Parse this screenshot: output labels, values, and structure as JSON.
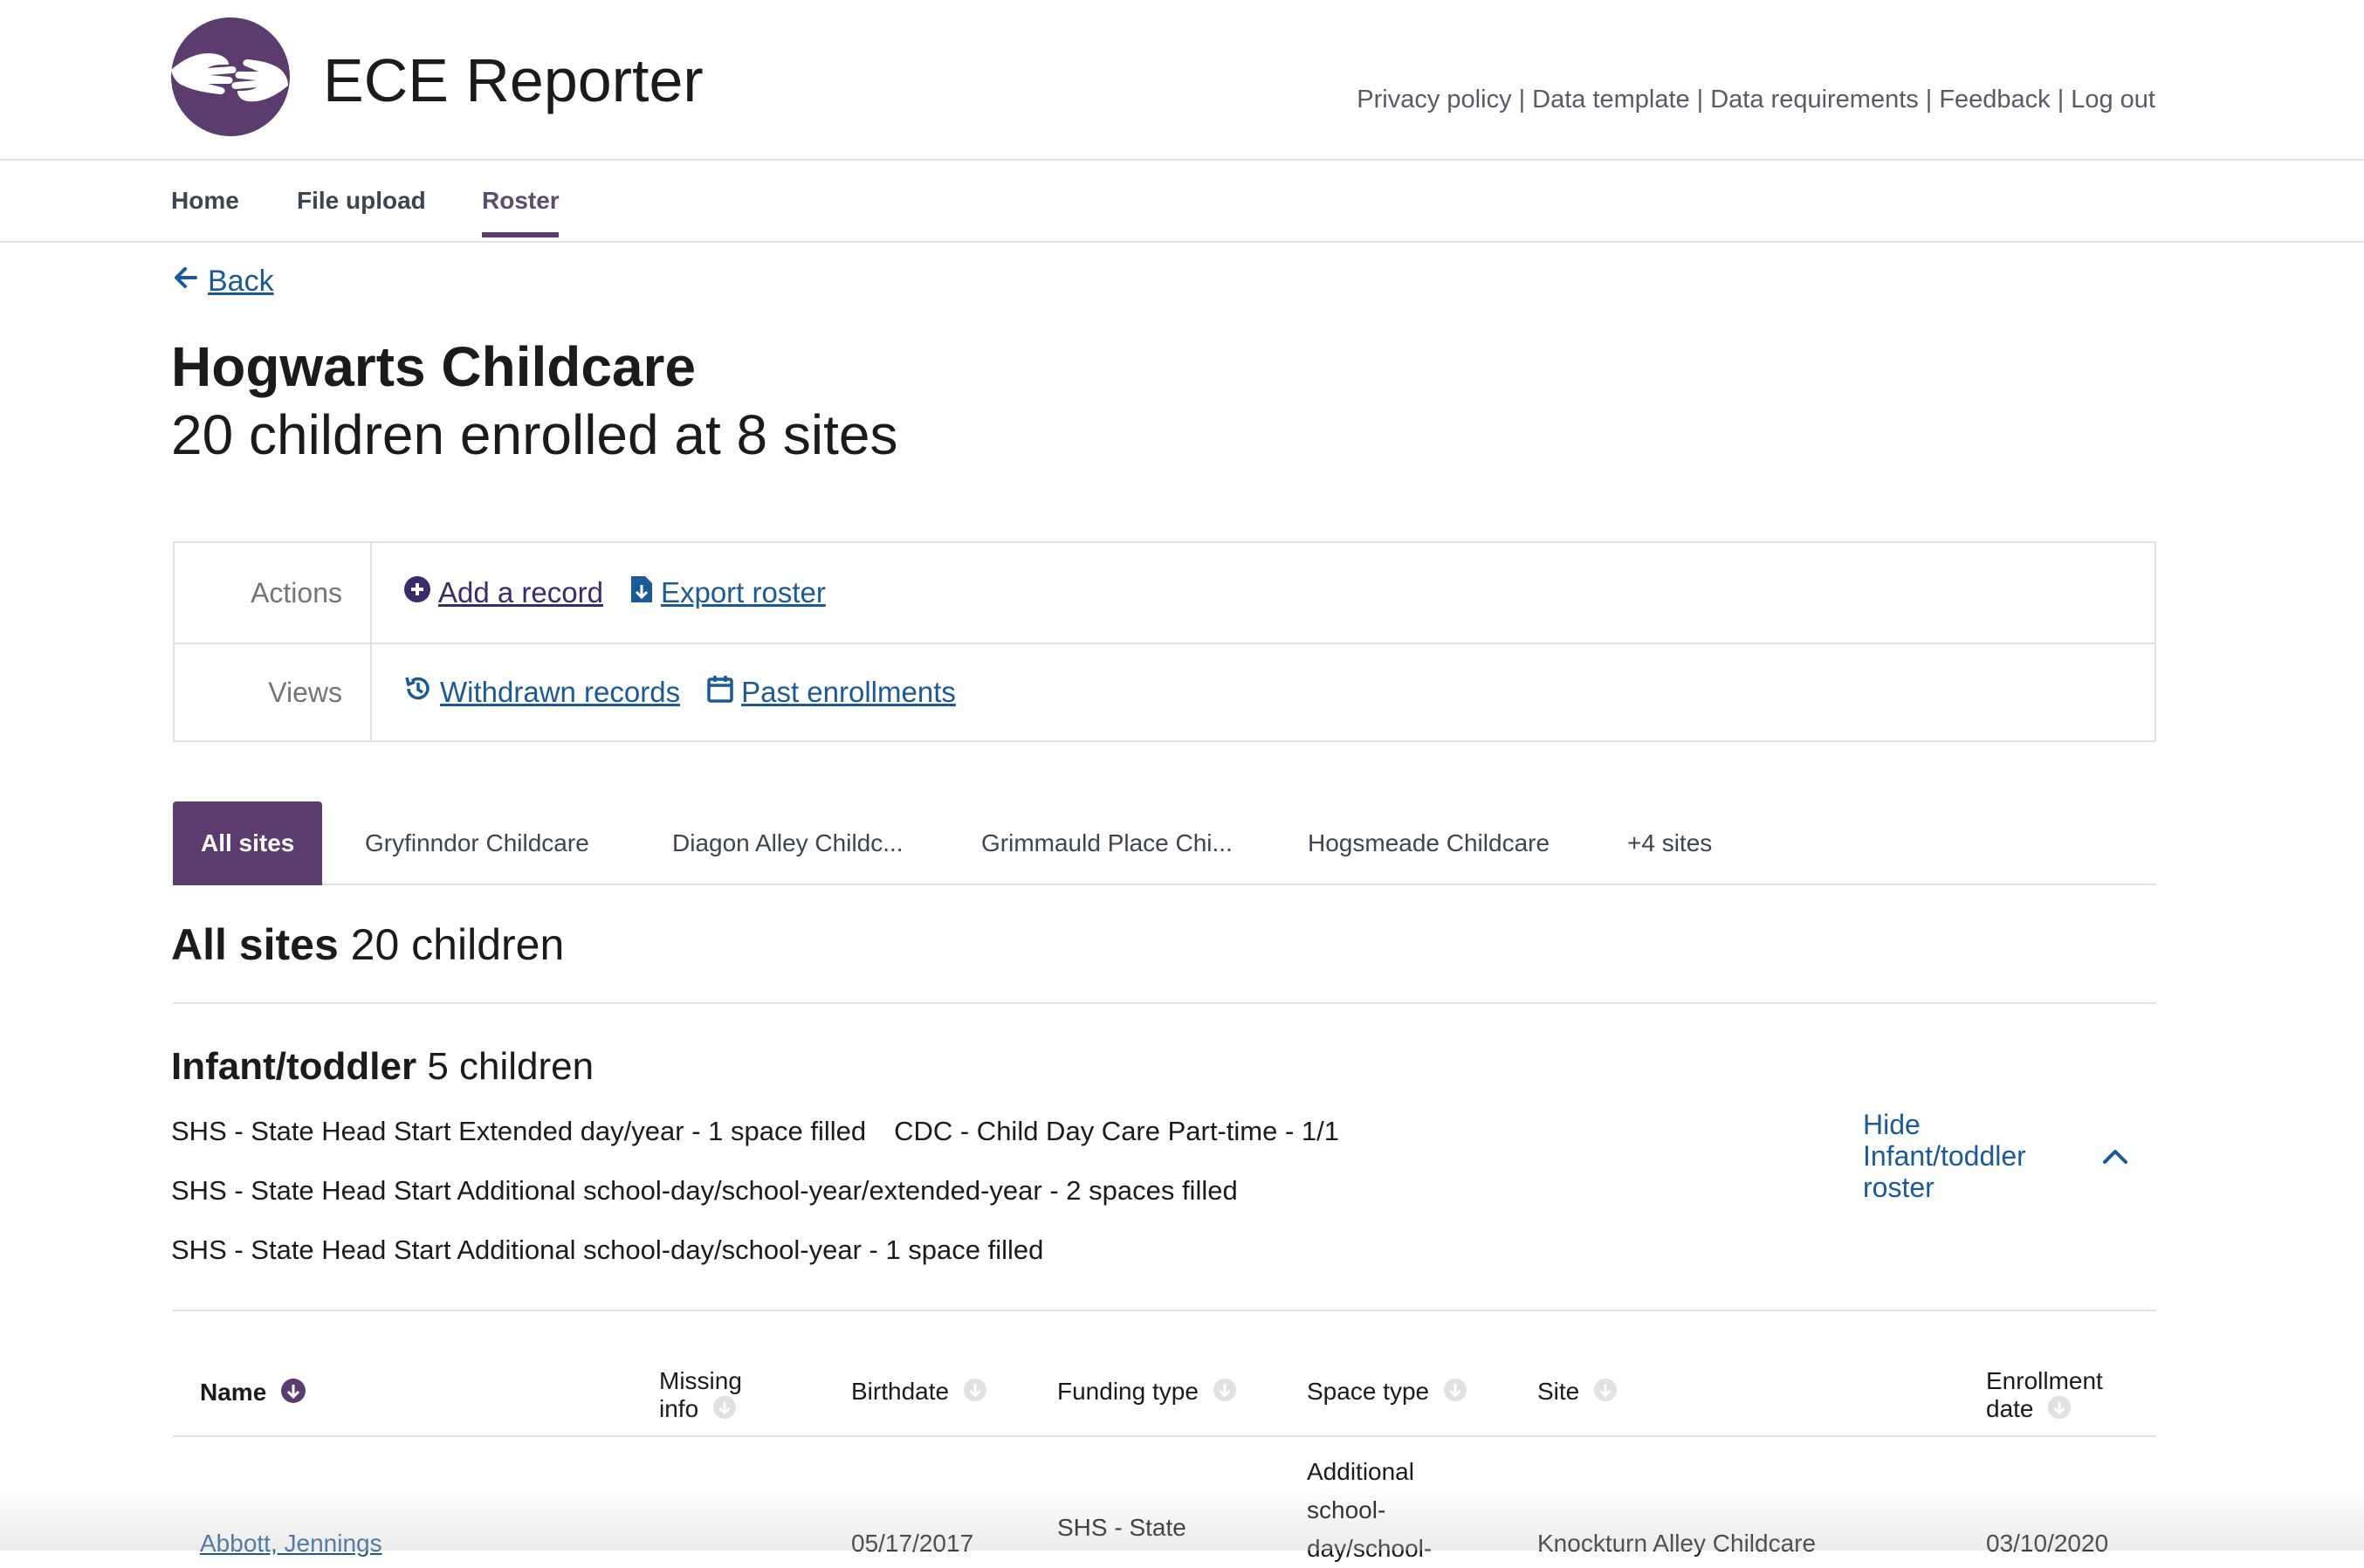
{
  "header": {
    "app_title": "ECE Reporter",
    "links": [
      "Privacy policy",
      "Data template",
      "Data requirements",
      "Feedback",
      "Log out"
    ],
    "separator": "|"
  },
  "nav": {
    "items": [
      "Home",
      "File upload",
      "Roster"
    ],
    "active": "Roster"
  },
  "back_label": "Back",
  "page": {
    "title": "Hogwarts Childcare",
    "subtitle": "20 children enrolled at 8 sites"
  },
  "actions": {
    "actions_label": "Actions",
    "add_record": "Add a record",
    "export_roster": "Export roster",
    "views_label": "Views",
    "withdrawn_records": "Withdrawn records",
    "past_enrollments": "Past enrollments"
  },
  "site_tabs": [
    "All sites",
    "Gryfinndor Childcare",
    "Diagon Alley Childc...",
    "Grimmauld Place Chi...",
    "Hogsmeade Childcare",
    "+4 sites"
  ],
  "all_sites": {
    "label": "All sites",
    "count": "20 children"
  },
  "group": {
    "label": "Infant/toddler",
    "count": "5 children",
    "capacity": [
      "SHS - State Head Start Extended day/year - 1 space filled",
      "CDC - Child Day Care Part-time - 1/1",
      "SHS - State Head Start Additional school-day/school-year/extended-year - 2 spaces filled",
      "SHS - State Head Start Additional school-day/school-year - 1 space filled"
    ],
    "hide_label": "Hide Infant/toddler roster"
  },
  "table": {
    "columns": [
      "Name",
      "Missing info",
      "Birthdate",
      "Funding type",
      "Space type",
      "Site",
      "Enrollment date"
    ],
    "rows": [
      {
        "name": "Abbott, Jennings",
        "birthdate": "05/17/2017",
        "funding": "SHS - State",
        "space_type": "Additional school- day/school-",
        "site": "Knockturn Alley Childcare",
        "enrollment_date": "03/10/2020"
      }
    ]
  },
  "colors": {
    "brand_purple": "#5c3c6e",
    "link_blue": "#1a5a96",
    "border": "#dfe1e2"
  }
}
